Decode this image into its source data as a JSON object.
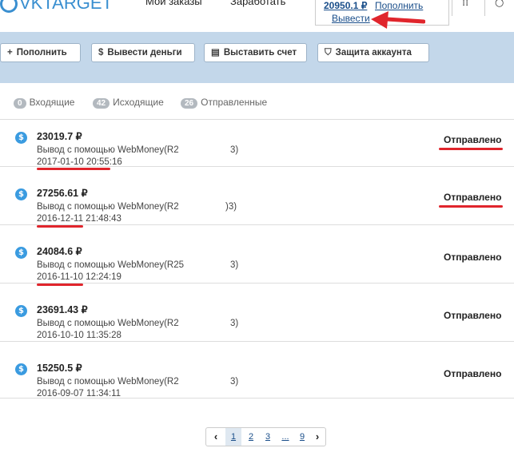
{
  "header": {
    "logo_text": "VKTARGET",
    "nav": [
      "Мои заказы",
      "Заработать"
    ],
    "balance": "20950.1 ₽",
    "topup_link": "Пополнить",
    "withdraw_link": "Вывести"
  },
  "actions": [
    {
      "icon": "+",
      "label": "Пополнить"
    },
    {
      "icon": "$",
      "label": "Вывести деньги"
    },
    {
      "icon": "▤",
      "label": "Выставить счет"
    },
    {
      "icon": "⛉",
      "label": "Защита аккаунта"
    }
  ],
  "tabs": [
    {
      "count": "0",
      "label": "Входящие"
    },
    {
      "count": "42",
      "label": "Исходящие"
    },
    {
      "count": "26",
      "label": "Отправленные"
    }
  ],
  "transactions": [
    {
      "amount": "23019.7 ₽",
      "desc": "Вывод с помощью WebMoney(R2",
      "desc_tail": "3)",
      "date": "2017-01-10 20:55:16",
      "status": "Отправлено"
    },
    {
      "amount": "27256.61 ₽",
      "desc": "Вывод с помощью WebMoney(R2",
      "desc_tail": ")3)",
      "date": "2016-12-11 21:48:43",
      "status": "Отправлено"
    },
    {
      "amount": "24084.6 ₽",
      "desc": "Вывод с помощью WebMoney(R25",
      "desc_tail": "3)",
      "date": "2016-11-10 12:24:19",
      "status": "Отправлено"
    },
    {
      "amount": "23691.43 ₽",
      "desc": "Вывод с помощью WebMoney(R2",
      "desc_tail": "3)",
      "date": "2016-10-10 11:35:28",
      "status": "Отправлено"
    },
    {
      "amount": "15250.5 ₽",
      "desc": "Вывод с помощью WebMoney(R2",
      "desc_tail": "3)",
      "date": "2016-09-07 11:34:11",
      "status": "Отправлено"
    }
  ],
  "pagination": {
    "prev": "‹",
    "pages": [
      "1",
      "2",
      "3",
      "...",
      "9"
    ],
    "next": "›",
    "current": "1"
  },
  "colors": {
    "action_bar": "#c3d7ea",
    "accent": "#3a9be0",
    "annotation_red": "#e0252c"
  }
}
